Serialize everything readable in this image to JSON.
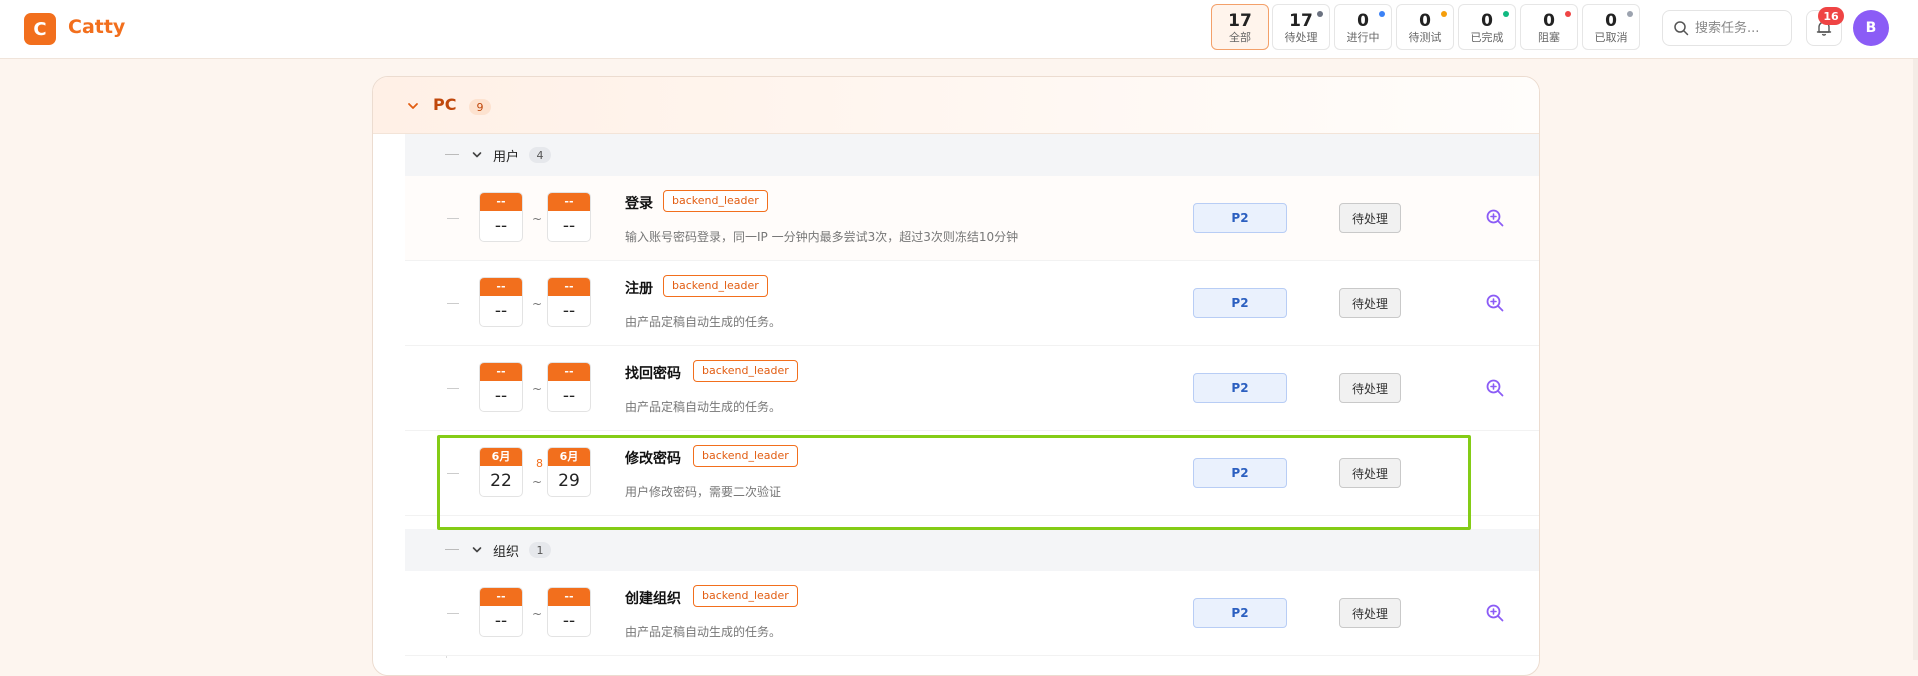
{
  "app": {
    "logo_letter": "C",
    "name": "Catty"
  },
  "stats": [
    {
      "count": "17",
      "label": "全部",
      "dot": ""
    },
    {
      "count": "17",
      "label": "待处理",
      "dot": "#6b7280"
    },
    {
      "count": "0",
      "label": "进行中",
      "dot": "#3b82f6"
    },
    {
      "count": "0",
      "label": "待测试",
      "dot": "#f59e0b"
    },
    {
      "count": "0",
      "label": "已完成",
      "dot": "#10b981"
    },
    {
      "count": "0",
      "label": "阻塞",
      "dot": "#ef4444"
    },
    {
      "count": "0",
      "label": "已取消",
      "dot": "#9ca3af"
    }
  ],
  "search": {
    "placeholder": "搜索任务..."
  },
  "notifications": {
    "count": "16"
  },
  "user": {
    "initial": "B"
  },
  "project": {
    "name": "PC",
    "count": "9",
    "modules": [
      {
        "name": "用户",
        "count": "4",
        "tasks": [
          {
            "start_month": "--",
            "start_day": "--",
            "end_month": "--",
            "end_day": "--",
            "duration": "",
            "title": "登录",
            "tag": "backend_leader",
            "desc": "输入账号密码登录，同一IP 一分钟内最多尝试3次，超过3次则冻结10分钟",
            "priority": "P2",
            "status": "待处理",
            "zoom_icon": "zoom-in-icon"
          },
          {
            "start_month": "--",
            "start_day": "--",
            "end_month": "--",
            "end_day": "--",
            "duration": "",
            "title": "注册",
            "tag": "backend_leader",
            "desc": "由产品定稿自动生成的任务。",
            "priority": "P2",
            "status": "待处理",
            "zoom_icon": "zoom-in-icon"
          },
          {
            "start_month": "--",
            "start_day": "--",
            "end_month": "--",
            "end_day": "--",
            "duration": "",
            "title": "找回密码",
            "tag": "backend_leader",
            "desc": "由产品定稿自动生成的任务。",
            "priority": "P2",
            "status": "待处理",
            "zoom_icon": "zoom-in-icon"
          },
          {
            "start_month": "6月",
            "start_day": "22",
            "end_month": "6月",
            "end_day": "29",
            "duration": "8",
            "title": "修改密码",
            "tag": "backend_leader",
            "desc": "用户修改密码，需要二次验证",
            "priority": "P2",
            "status": "待处理",
            "zoom_icon": ""
          }
        ]
      },
      {
        "name": "组织",
        "count": "1",
        "tasks": [
          {
            "start_month": "--",
            "start_day": "--",
            "end_month": "--",
            "end_day": "--",
            "duration": "",
            "title": "创建组织",
            "tag": "backend_leader",
            "desc": "由产品定稿自动生成的任务。",
            "priority": "P2",
            "status": "待处理",
            "zoom_icon": "zoom-in-icon"
          }
        ]
      }
    ]
  },
  "colors": {
    "accent": "#f26f1d",
    "highlight": "#84cc16",
    "priority_blue": "#2b5fc0"
  }
}
